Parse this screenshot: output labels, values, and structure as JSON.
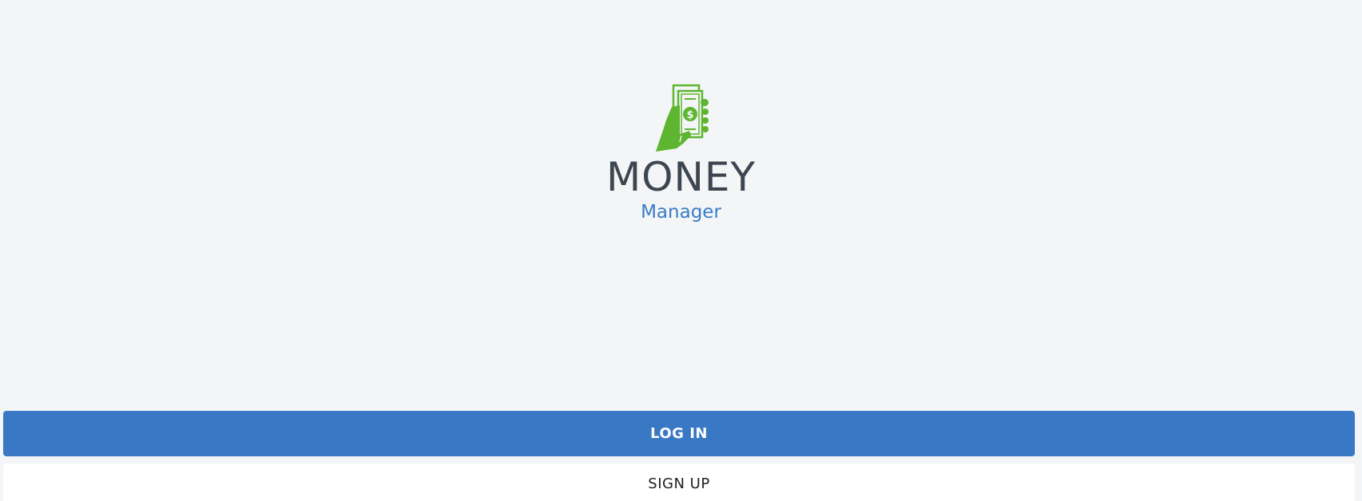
{
  "brand": {
    "title": "MONEY",
    "subtitle": "Manager",
    "logo_icon": "hand-holding-money-icon",
    "logo_color": "#5eb52f",
    "title_color": "#3d4650",
    "subtitle_color": "#3a7cc4"
  },
  "actions": {
    "login_label": "LOG IN",
    "signup_label": "SIGN UP",
    "login_color": "#3878c4"
  }
}
